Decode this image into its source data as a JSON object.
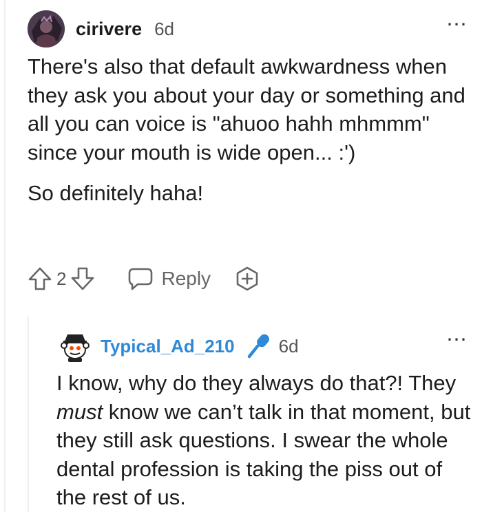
{
  "comments": [
    {
      "username": "cirivere",
      "time": "6d",
      "paragraphs": [
        "There's also that default awkwardness when they ask you about your day or something and all you can voice is \"ahuoo hahh mhmmm\" since your mouth is wide open... :')",
        "So definitely haha!"
      ],
      "vote_count": "2",
      "reply_label": "Reply",
      "more_icon": "⋯"
    },
    {
      "username": "Typical_Ad_210",
      "time": "6d",
      "text_before": "I know, why do they always do that?! They ",
      "text_emphasis": "must",
      "text_after": " know we can’t talk in that moment, but they still ask questions. I swear the whole dental profession is taking the piss out of the rest of us.",
      "more_icon": "⋯"
    }
  ],
  "colors": {
    "username_op": "#1c1c1c",
    "username_reply": "#2f89d6",
    "mic_icon": "#2f89d6",
    "meta": "#555555"
  },
  "icons": [
    "avatar",
    "upvote-icon",
    "downvote-icon",
    "reply-icon",
    "award-icon",
    "microphone-icon",
    "more-options-icon"
  ]
}
